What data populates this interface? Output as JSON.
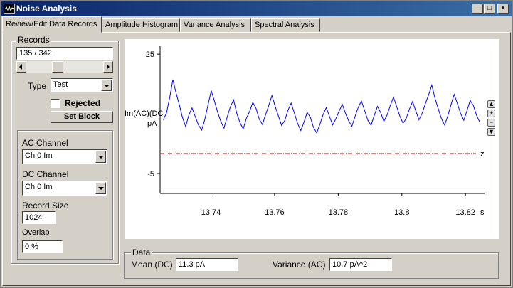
{
  "window": {
    "title": "Noise Analysis"
  },
  "tabs": [
    {
      "label": "Review/Edit Data Records",
      "active": true
    },
    {
      "label": "Amplitude Histogram"
    },
    {
      "label": "Variance Analysis"
    },
    {
      "label": "Spectral Analysis"
    }
  ],
  "records": {
    "group_label": "Records",
    "value": "135 / 342",
    "type_label": "Type",
    "type_value": "Test",
    "rejected_label": "Rejected",
    "rejected_checked": false,
    "set_block_label": "Set Block"
  },
  "channels": {
    "ac_label": "AC Channel",
    "ac_value": "Ch.0 Im",
    "dc_label": "DC Channel",
    "dc_value": "Ch.0 Im",
    "record_size_label": "Record Size",
    "record_size_value": "1024",
    "overlap_label": "Overlap",
    "overlap_value": "0 %"
  },
  "data_box": {
    "group_label": "Data",
    "mean_label": "Mean (DC)",
    "mean_value": "11.3 pA",
    "variance_label": "Variance (AC)",
    "variance_value": "10.7 pA^2"
  },
  "chart_data": {
    "type": "line",
    "ylabel_line1": "Im(AC)(DC",
    "ylabel_line2": "pA",
    "y_ticks": [
      "25",
      "-5"
    ],
    "x_ticks": [
      "13.74",
      "13.76",
      "13.78",
      "13.8",
      "13.82"
    ],
    "x_unit": "s",
    "zero_label": "z",
    "xlim": [
      13.724,
      13.826
    ],
    "ylim": [
      -10,
      27
    ],
    "zero_level": 0,
    "series_color": "#0000ff",
    "zero_color": "#cc0000",
    "series": [
      {
        "x_start": 13.725,
        "x_end": 13.8245,
        "values": [
          8.5,
          10.2,
          14.1,
          18.6,
          15.3,
          12.4,
          9.1,
          6.8,
          9.7,
          11.5,
          9.3,
          7.2,
          5.9,
          8.6,
          12.3,
          15.8,
          13.2,
          10.4,
          8.1,
          6.4,
          9.2,
          11.8,
          13.5,
          10.1,
          7.8,
          6.2,
          8.9,
          10.6,
          12.9,
          11.4,
          8.7,
          7.3,
          9.8,
          12.1,
          14.6,
          11.9,
          9.5,
          7.1,
          8.3,
          10.9,
          12.7,
          10.2,
          7.6,
          5.8,
          7.9,
          10.4,
          9.1,
          6.6,
          5.2,
          7.4,
          9.8,
          11.6,
          9.3,
          7.2,
          8.8,
          10.7,
          12.4,
          10.1,
          8.2,
          6.9,
          9.4,
          11.7,
          13.2,
          10.8,
          8.4,
          7.1,
          9.6,
          11.9,
          10.3,
          8.1,
          9.7,
          12.1,
          14.2,
          11.8,
          9.4,
          7.6,
          8.9,
          11.2,
          13.1,
          10.7,
          8.5,
          10.2,
          12.6,
          14.8,
          17.2,
          13.9,
          11.3,
          8.8,
          7.2,
          9.5,
          12.3,
          14.9,
          12.6,
          10.1,
          8.4,
          10.8,
          13.4,
          12.1,
          9.6,
          7.9
        ]
      }
    ]
  }
}
